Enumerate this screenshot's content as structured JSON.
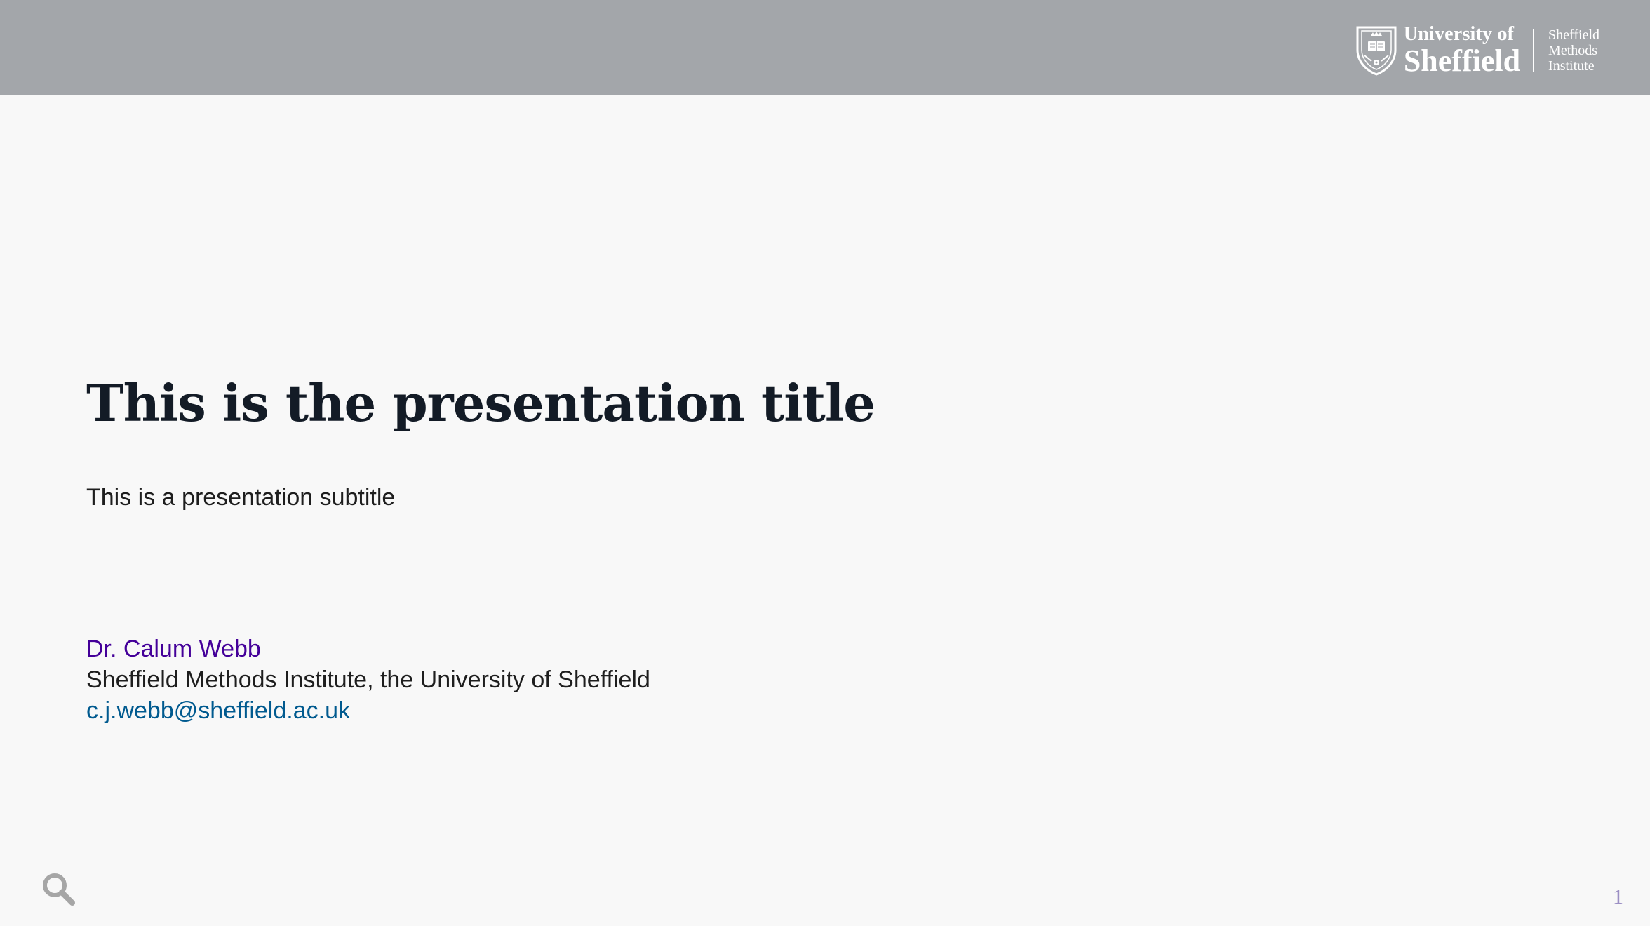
{
  "header": {
    "logo": {
      "line1": "University of",
      "line2": "Sheffield",
      "sub_lines": [
        "Sheffield",
        "Methods",
        "Institute"
      ],
      "crest_icon": "university-crest-icon"
    },
    "background_color": "#a3a6aa"
  },
  "slide": {
    "title": "This is the presentation title",
    "subtitle": "This is a presentation subtitle",
    "author": {
      "name": "Dr. Calum Webb",
      "affiliation": "Sheffield Methods Institute, the University of Sheffield",
      "email": "c.j.webb@sheffield.ac.uk"
    },
    "slide_number": "1"
  },
  "controls": {
    "search_icon": "search-icon"
  },
  "colors": {
    "title": "#131b26",
    "author_name": "#440099",
    "email_link": "#005a8f",
    "slide_number": "#9b8fc4",
    "background": "#f8f8f8"
  }
}
